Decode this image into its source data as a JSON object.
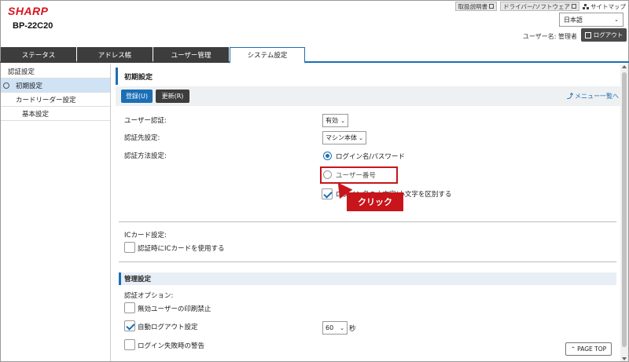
{
  "header": {
    "logo": "SHARP",
    "model": "BP-22C20",
    "links": [
      "取扱説明書",
      "ドライバー/ソフトウェア",
      "サイトマップ"
    ],
    "language": "日本語",
    "username": "ユーザー名: 管理者",
    "logout_label": "ログアウト"
  },
  "tabs": [
    {
      "label": "ステータス"
    },
    {
      "label": "アドレス帳"
    },
    {
      "label": "ユーザー管理"
    },
    {
      "label": "システム設定"
    }
  ],
  "sidebar": {
    "items": [
      {
        "label": "認証設定"
      },
      {
        "label": "初期設定"
      },
      {
        "label": "カードリーダー設定"
      },
      {
        "label": "基本設定"
      }
    ]
  },
  "main": {
    "title": "初期設定",
    "save_label": "登録(U)",
    "refresh_label": "更新(R)",
    "menu_back_label": "メニュー一覧へ",
    "user_auth_label": "ユーザー認証:",
    "user_auth_value": "有効",
    "auth_dest_label": "認証先設定:",
    "auth_dest_value": "マシン本体",
    "auth_method_label": "認証方法設定:",
    "radio_login_label": "ログイン名/パスワード",
    "radio_userno_label": "ユーザー番号",
    "case_sensitive_label": "ログイン名の大文字/小文字を区別する",
    "callout_label": "クリック",
    "ic_label": "ICカード設定:",
    "ic_check_label": "認証時にICカードを使用する",
    "admin_section": "管理設定",
    "auth_options_label": "認証オプション:",
    "disable_print_label": "無効ユーザーの印刷禁止",
    "auto_logout_label": "自動ログアウト設定",
    "auto_logout_value": "60",
    "seconds_label": "秒",
    "login_fail_label": "ログイン失敗時の警告",
    "pagetop_label": "PAGE TOP"
  },
  "colors": {
    "brand": "#d8141f",
    "accent": "#1a6fb5",
    "highlight": "#c8151b"
  }
}
